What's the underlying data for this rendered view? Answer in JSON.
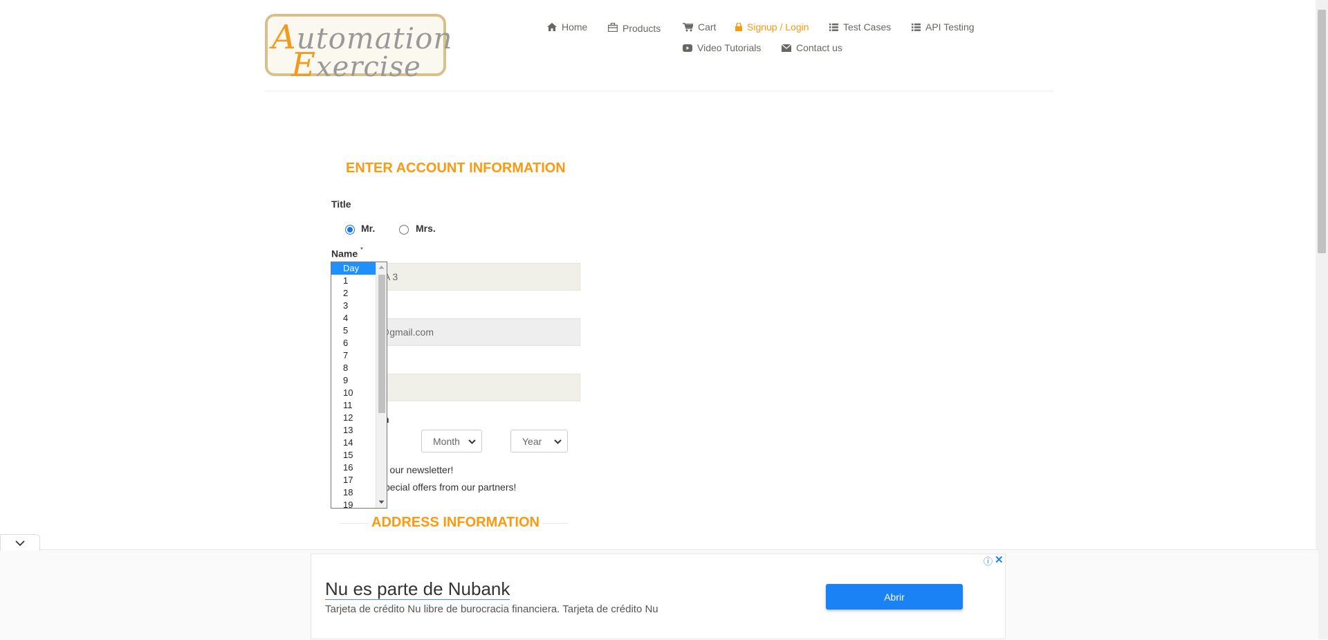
{
  "header": {
    "logo_line1_first": "A",
    "logo_line1_rest": "utomation",
    "logo_line2_first": "E",
    "logo_line2_rest": "xercise",
    "nav": {
      "home": "Home",
      "products": "Products",
      "cart": "Cart",
      "signup_login": "Signup / Login",
      "test_cases": "Test Cases",
      "api_testing": "API Testing",
      "video_tutorials": "Video Tutorials",
      "contact_us": "Contact us"
    },
    "active_color": "#fe980f"
  },
  "form": {
    "heading": "ENTER ACCOUNT INFORMATION",
    "title_label": "Title",
    "title_options": {
      "mr": "Mr.",
      "mrs": "Mrs."
    },
    "title_selected": "Mr.",
    "name_label": "Name",
    "required_mark": "*",
    "name_value_visible": "QA 3",
    "email_value_visible": "s@gmail.com",
    "dob_label_visible": "h",
    "month_select": "Month",
    "year_select": "Year",
    "newsletter_visible": "r our newsletter!",
    "offers_visible": "pecial offers from our partners!",
    "address_heading": "ADDRESS INFORMATION"
  },
  "day_dropdown": {
    "options": [
      "Day",
      "1",
      "2",
      "3",
      "4",
      "5",
      "6",
      "7",
      "8",
      "9",
      "10",
      "11",
      "12",
      "13",
      "14",
      "15",
      "16",
      "17",
      "18",
      "19"
    ],
    "selected": "Day"
  },
  "ad": {
    "title": "Nu es parte de Nubank",
    "description": "Tarjeta de crédito Nu libre de burocracia financiera. Tarjeta de crédito Nu",
    "button": "Abrir",
    "button_color": "#1a82f5"
  }
}
